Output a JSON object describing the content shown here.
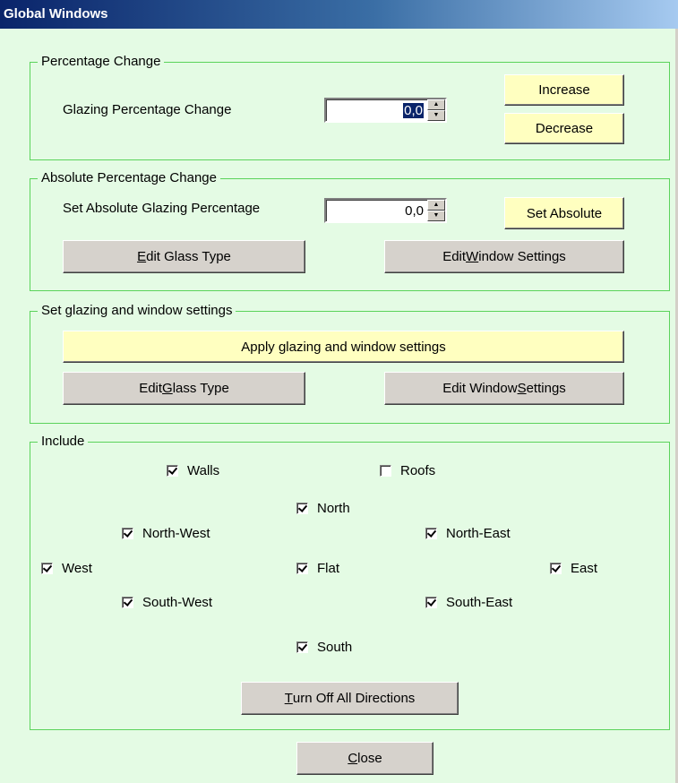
{
  "window": {
    "title": "Global Windows"
  },
  "percentage_change": {
    "legend": "Percentage Change",
    "label": "Glazing Percentage Change",
    "value": "0,0",
    "increase": "Increase",
    "decrease": "Decrease"
  },
  "absolute_change": {
    "legend": "Absolute Percentage Change",
    "label": "Set Absolute Glazing Percentage",
    "value": "0,0",
    "set_absolute": "Set Absolute",
    "edit_glass_pre": "",
    "edit_glass_key": "E",
    "edit_glass_post": "dit Glass Type",
    "edit_window_pre": "Edit ",
    "edit_window_key": "W",
    "edit_window_post": "indow Settings"
  },
  "glazing_settings": {
    "legend": "Set glazing and window settings",
    "apply": "Apply glazing and window settings",
    "edit_glass_pre": "Edit ",
    "edit_glass_key": "G",
    "edit_glass_post": "lass Type",
    "edit_window_pre": "Edit Window ",
    "edit_window_key": "S",
    "edit_window_post": "ettings"
  },
  "include": {
    "legend": "Include",
    "walls": {
      "label": "Walls",
      "checked": true
    },
    "roofs": {
      "label": "Roofs",
      "checked": false
    },
    "north": {
      "label": "North",
      "checked": true
    },
    "north_west": {
      "label": "North-West",
      "checked": true
    },
    "north_east": {
      "label": "North-East",
      "checked": true
    },
    "west": {
      "label": "West",
      "checked": true
    },
    "flat": {
      "label": "Flat",
      "checked": true
    },
    "east": {
      "label": "East",
      "checked": true
    },
    "south_west": {
      "label": "South-West",
      "checked": true
    },
    "south_east": {
      "label": "South-East",
      "checked": true
    },
    "south": {
      "label": "South",
      "checked": true
    },
    "turn_off_key": "T",
    "turn_off_post": "urn Off All Directions"
  },
  "close_key": "C",
  "close_post": "lose"
}
